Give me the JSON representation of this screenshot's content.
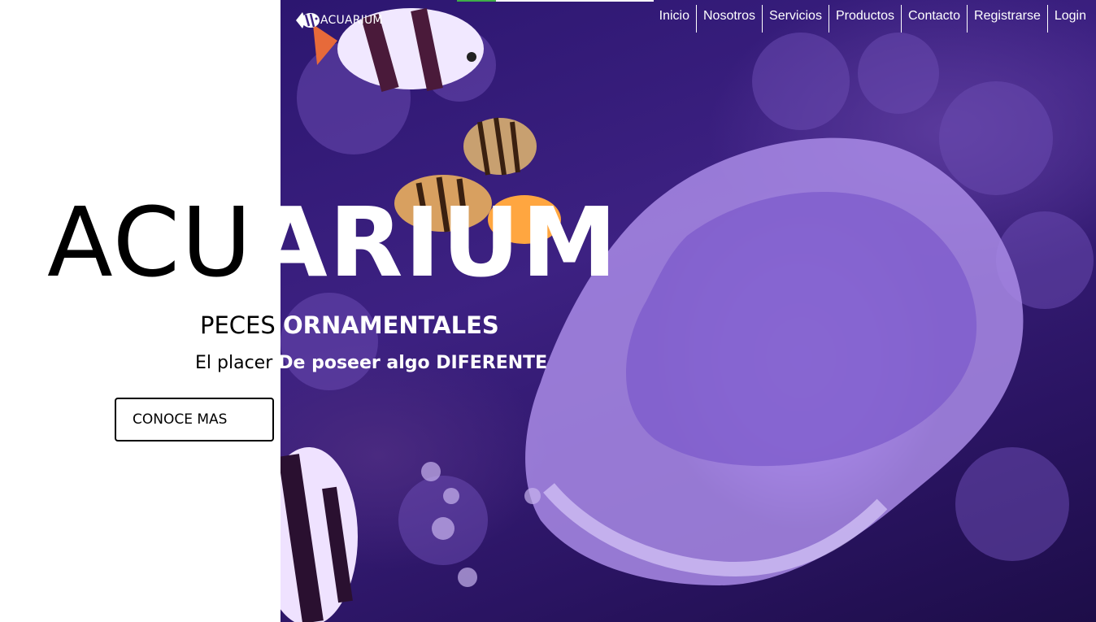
{
  "brand": {
    "name": "ACUARIUM",
    "logo_icon": "fish-logo-icon"
  },
  "nav": {
    "items": [
      {
        "label": "Inicio"
      },
      {
        "label": "Nosotros"
      },
      {
        "label": "Servicios"
      },
      {
        "label": "Productos"
      },
      {
        "label": "Contacto"
      },
      {
        "label": "Registrarse"
      },
      {
        "label": "Login"
      }
    ]
  },
  "hero": {
    "title_light": "ACU",
    "title_bold": "ARIUM",
    "subtitle_light": "PECES ",
    "subtitle_bold": "ORNAMENTALES",
    "tagline_light": "El placer ",
    "tagline_bold": "De poseer algo DIFERENTE",
    "cta_label": "CONOCE MAS",
    "background_image": "coral-reef-fish-photo"
  },
  "loading_bar": {
    "progress": 0.2,
    "fill_color": "#3fae49"
  },
  "colors": {
    "overlay_purple": "#3d2182",
    "text_dark": "#000000",
    "text_light": "#ffffff"
  }
}
